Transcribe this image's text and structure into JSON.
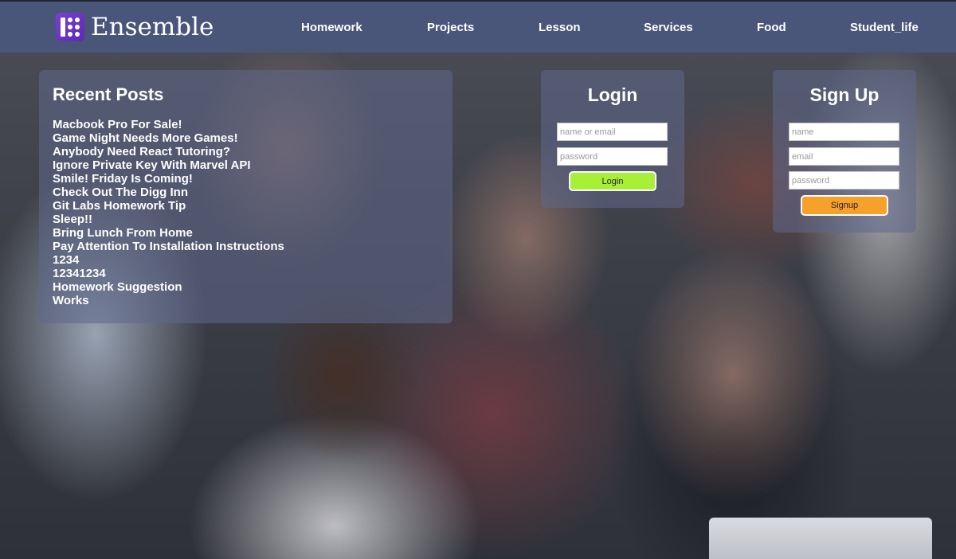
{
  "brand": {
    "name": "Ensemble",
    "logo_color": "#6a33c2"
  },
  "nav": {
    "items": [
      "Homework",
      "Projects",
      "Lesson",
      "Services",
      "Food",
      "Student_life"
    ]
  },
  "recent_posts": {
    "title": "Recent Posts",
    "items": [
      "Macbook Pro For Sale!",
      "Game Night Needs More Games!",
      "Anybody Need React Tutoring?",
      "Ignore Private Key With Marvel API",
      "Smile! Friday Is Coming!",
      "Check Out The Digg Inn",
      "Git Labs Homework Tip",
      "Sleep!!",
      "Bring Lunch From Home",
      "Pay Attention To Installation Instructions",
      "1234",
      "12341234",
      "Homework Suggestion",
      "Works"
    ]
  },
  "login": {
    "title": "Login",
    "username_placeholder": "name or email",
    "password_placeholder": "password",
    "button_label": "Login",
    "button_color": "#a8f038"
  },
  "signup": {
    "title": "Sign Up",
    "name_placeholder": "name",
    "email_placeholder": "email",
    "password_placeholder": "password",
    "button_label": "Signup",
    "button_color": "#f7a12a"
  },
  "colors": {
    "navbar": "#4a5679",
    "panel": "rgba(95,104,140,0.55)"
  }
}
